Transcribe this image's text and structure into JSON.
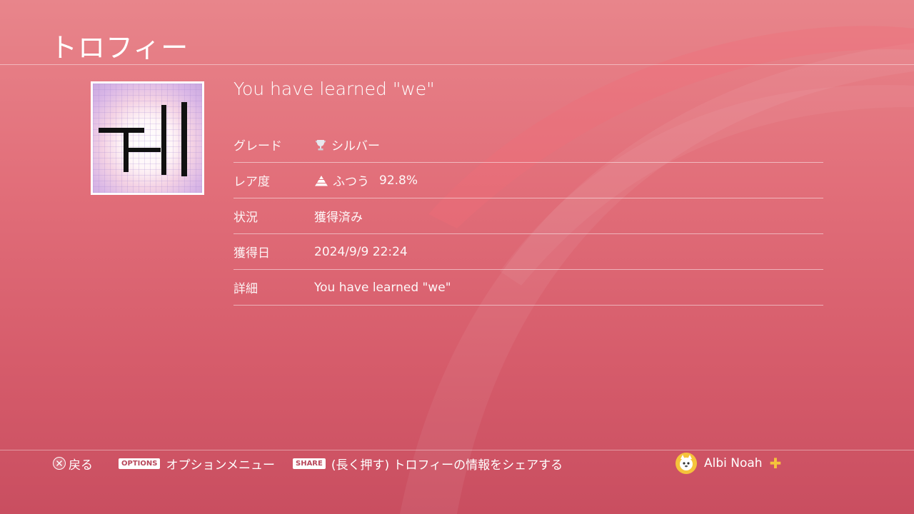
{
  "header": {
    "title": "トロフィー"
  },
  "trophy": {
    "name": "You have learned \"we\"",
    "art_icon": "trophy-artwork-icon"
  },
  "details": [
    {
      "key": "grade",
      "label": "グレード",
      "value": "シルバー",
      "icon": "silver-trophy-icon"
    },
    {
      "key": "rarity",
      "label": "レア度",
      "value": "ふつう",
      "extra": "92.8%",
      "icon": "rarity-pyramid-icon"
    },
    {
      "key": "status",
      "label": "状況",
      "value": "獲得済み"
    },
    {
      "key": "earned",
      "label": "獲得日",
      "value": "2024/9/9 22:24"
    },
    {
      "key": "detail",
      "label": "詳細",
      "value": "You have learned \"we\""
    }
  ],
  "footer": {
    "back": {
      "icon": "cross-button-icon",
      "label": "戻る"
    },
    "options": {
      "pill": "OPTIONS",
      "label": "オプションメニュー"
    },
    "share": {
      "pill": "SHARE",
      "label": "(長く押す) トロフィーの情報をシェアする"
    },
    "user": {
      "name": "Albi Noah",
      "avatar": "user-avatar",
      "plus_icon": "ps-plus-icon"
    }
  },
  "colors": {
    "background_top": "#e8858b",
    "background_bottom": "#c94e60",
    "ps_plus": "#f5c33b"
  }
}
